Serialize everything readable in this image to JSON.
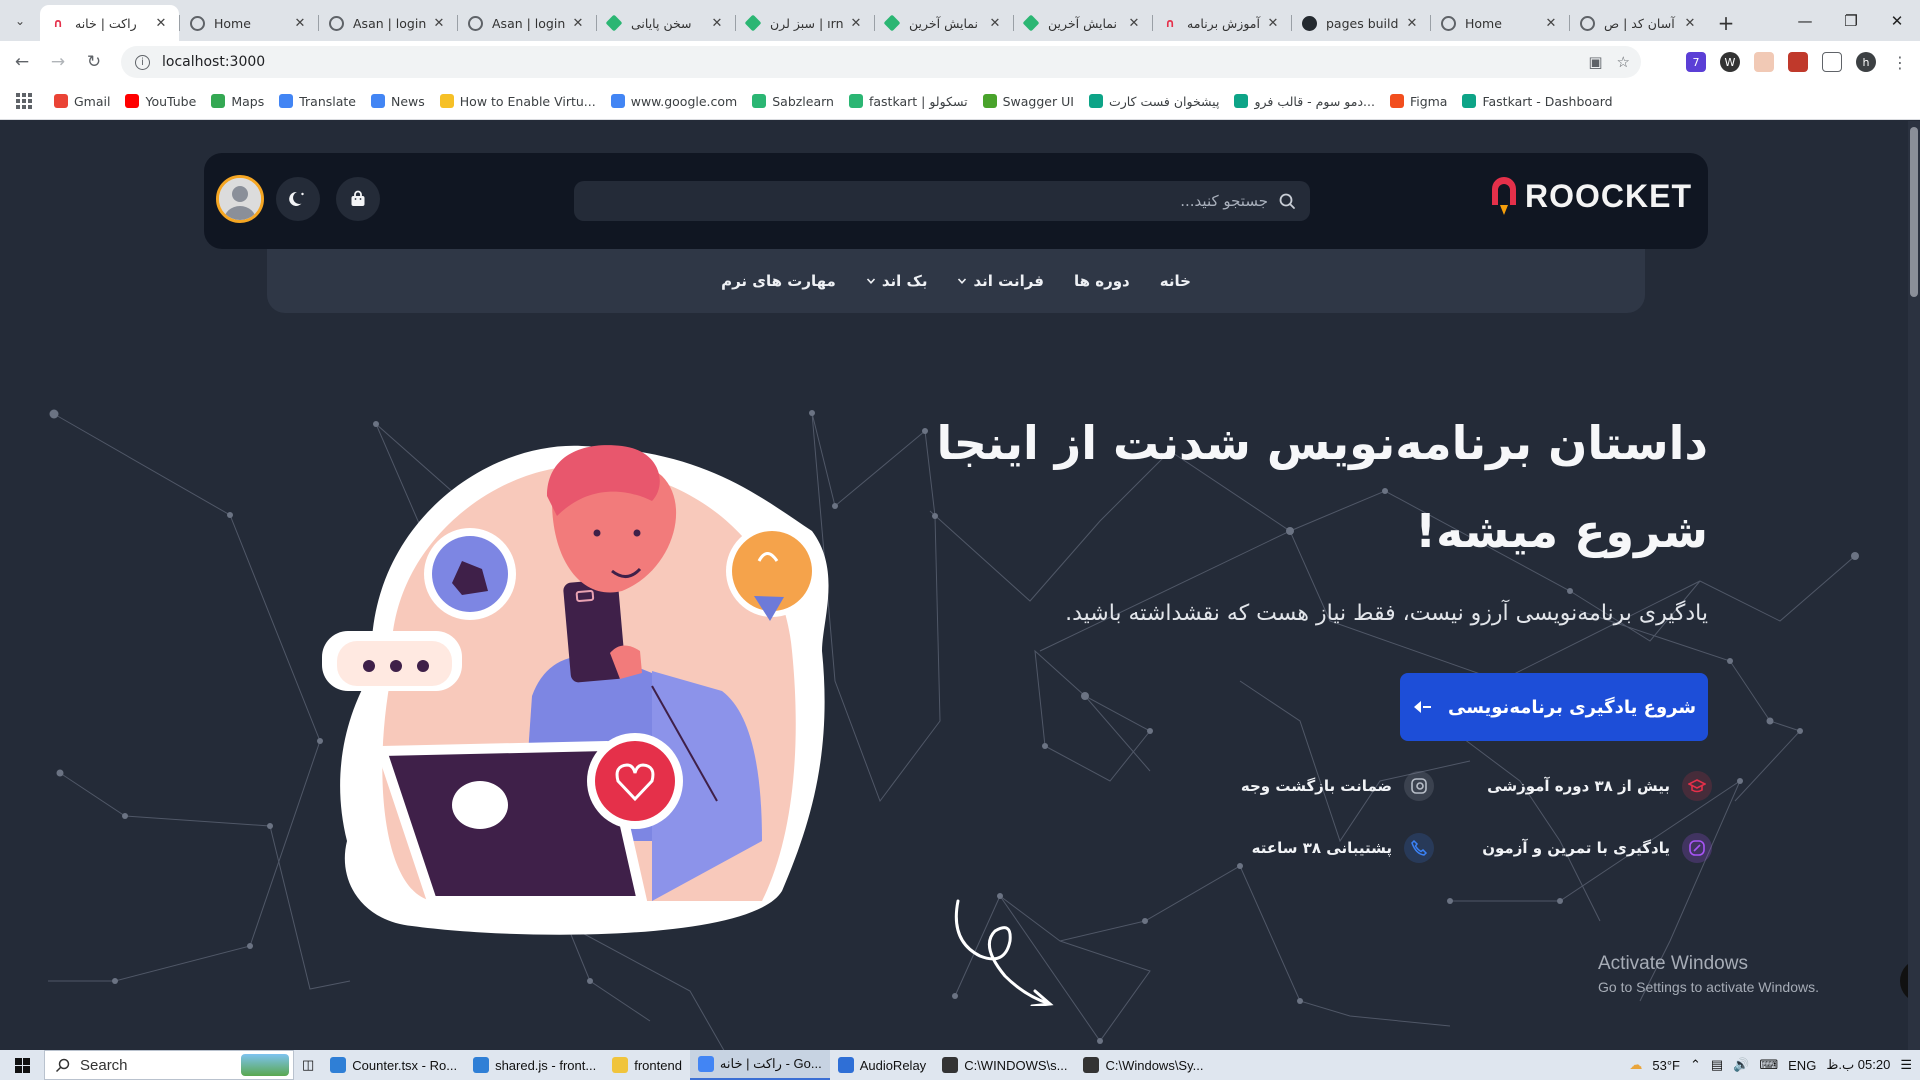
{
  "browser": {
    "tabs": [
      {
        "title": "راکت | خانه",
        "active": true,
        "favicon": "roocket-icon"
      },
      {
        "title": "Home",
        "favicon": "globe-icon"
      },
      {
        "title": "Asan | login",
        "favicon": "globe-icon"
      },
      {
        "title": "Asan | login",
        "favicon": "globe-icon"
      },
      {
        "title": "سخن پایانی",
        "favicon": "sabzlearn-icon"
      },
      {
        "title": "سبز لرن | ırn",
        "favicon": "sabzlearn-icon"
      },
      {
        "title": "نمایش آخرین",
        "favicon": "sabzlearn-icon"
      },
      {
        "title": "نمایش آخرین",
        "favicon": "sabzlearn-icon"
      },
      {
        "title": "آموزش برنامه",
        "favicon": "roocket-icon"
      },
      {
        "title": "pages build",
        "favicon": "github-icon"
      },
      {
        "title": "Home",
        "favicon": "globe-icon"
      },
      {
        "title": "آسان کد | ص",
        "favicon": "globe-icon"
      }
    ],
    "url": "localhost:3000",
    "bookmarks": [
      {
        "label": "Gmail",
        "color": "#ea4335"
      },
      {
        "label": "YouTube",
        "color": "#ff0000"
      },
      {
        "label": "Maps",
        "color": "#34a853"
      },
      {
        "label": "Translate",
        "color": "#4285f4"
      },
      {
        "label": "News",
        "color": "#4285f4"
      },
      {
        "label": "How to Enable Virtu...",
        "color": "#f6c026"
      },
      {
        "label": "www.google.com",
        "color": "#4285f4"
      },
      {
        "label": "Sabzlearn",
        "color": "#2bb673"
      },
      {
        "label": "fastkart | تسکولو",
        "color": "#2bb673"
      },
      {
        "label": "Swagger UI",
        "color": "#49a32b"
      },
      {
        "label": "پیشخوان فست کارت",
        "color": "#0da487"
      },
      {
        "label": "دمو سوم - قالب فرو...",
        "color": "#0da487"
      },
      {
        "label": "Figma",
        "color": "#f24e1e"
      },
      {
        "label": "Fastkart - Dashboard",
        "color": "#0da487"
      }
    ]
  },
  "site": {
    "logo_text": "ROOCKET",
    "search_placeholder": "جستجو کنید...",
    "nav": [
      {
        "label": "خانه",
        "dropdown": false
      },
      {
        "label": "دوره ها",
        "dropdown": false
      },
      {
        "label": "فرانت اند",
        "dropdown": true
      },
      {
        "label": "بک اند",
        "dropdown": true
      },
      {
        "label": "مهارت های نرم",
        "dropdown": false
      }
    ],
    "hero": {
      "title_line1": "داستان برنامه‌نویس شدنت از اینجا",
      "title_line2": "شروع میشه!",
      "subtitle": "یادگیری برنامه‌نویسی آرزو نیست، فقط نیاز هست که نقشداشته باشید.",
      "cta": "شروع یادگیری برنامه‌نویسی"
    },
    "features": [
      {
        "label": "بیش از ۳۸ دوره آموزشی",
        "icon": "graduation-cap-icon",
        "color": "#e5304a"
      },
      {
        "label": "ضمانت بازگشت وجه",
        "icon": "money-back-icon",
        "color": "#9aa1ad"
      },
      {
        "label": "یادگیری با تمرین و آزمون",
        "icon": "pencil-icon",
        "color": "#a855f7"
      },
      {
        "label": "پشتیبانی ۳۸ ساعته",
        "icon": "phone-icon",
        "color": "#3b82f6"
      }
    ],
    "colors": {
      "accent": "#1d4ed8",
      "brand": "#e5304a",
      "bg": "#242b38",
      "header": "#101622"
    }
  },
  "overlay": {
    "activate_title": "Activate Windows",
    "activate_sub": "Go to Settings to activate Windows."
  },
  "taskbar": {
    "search": "Search",
    "items": [
      "Counter.tsx - Ro...",
      "shared.js - front...",
      "frontend",
      "راکت | خانه - Go...",
      "AudioRelay",
      "C:\\WINDOWS\\s...",
      "C:\\Windows\\Sy..."
    ],
    "weather": "53°F",
    "lang": "ENG",
    "time": "05:20 ب.ظ"
  }
}
